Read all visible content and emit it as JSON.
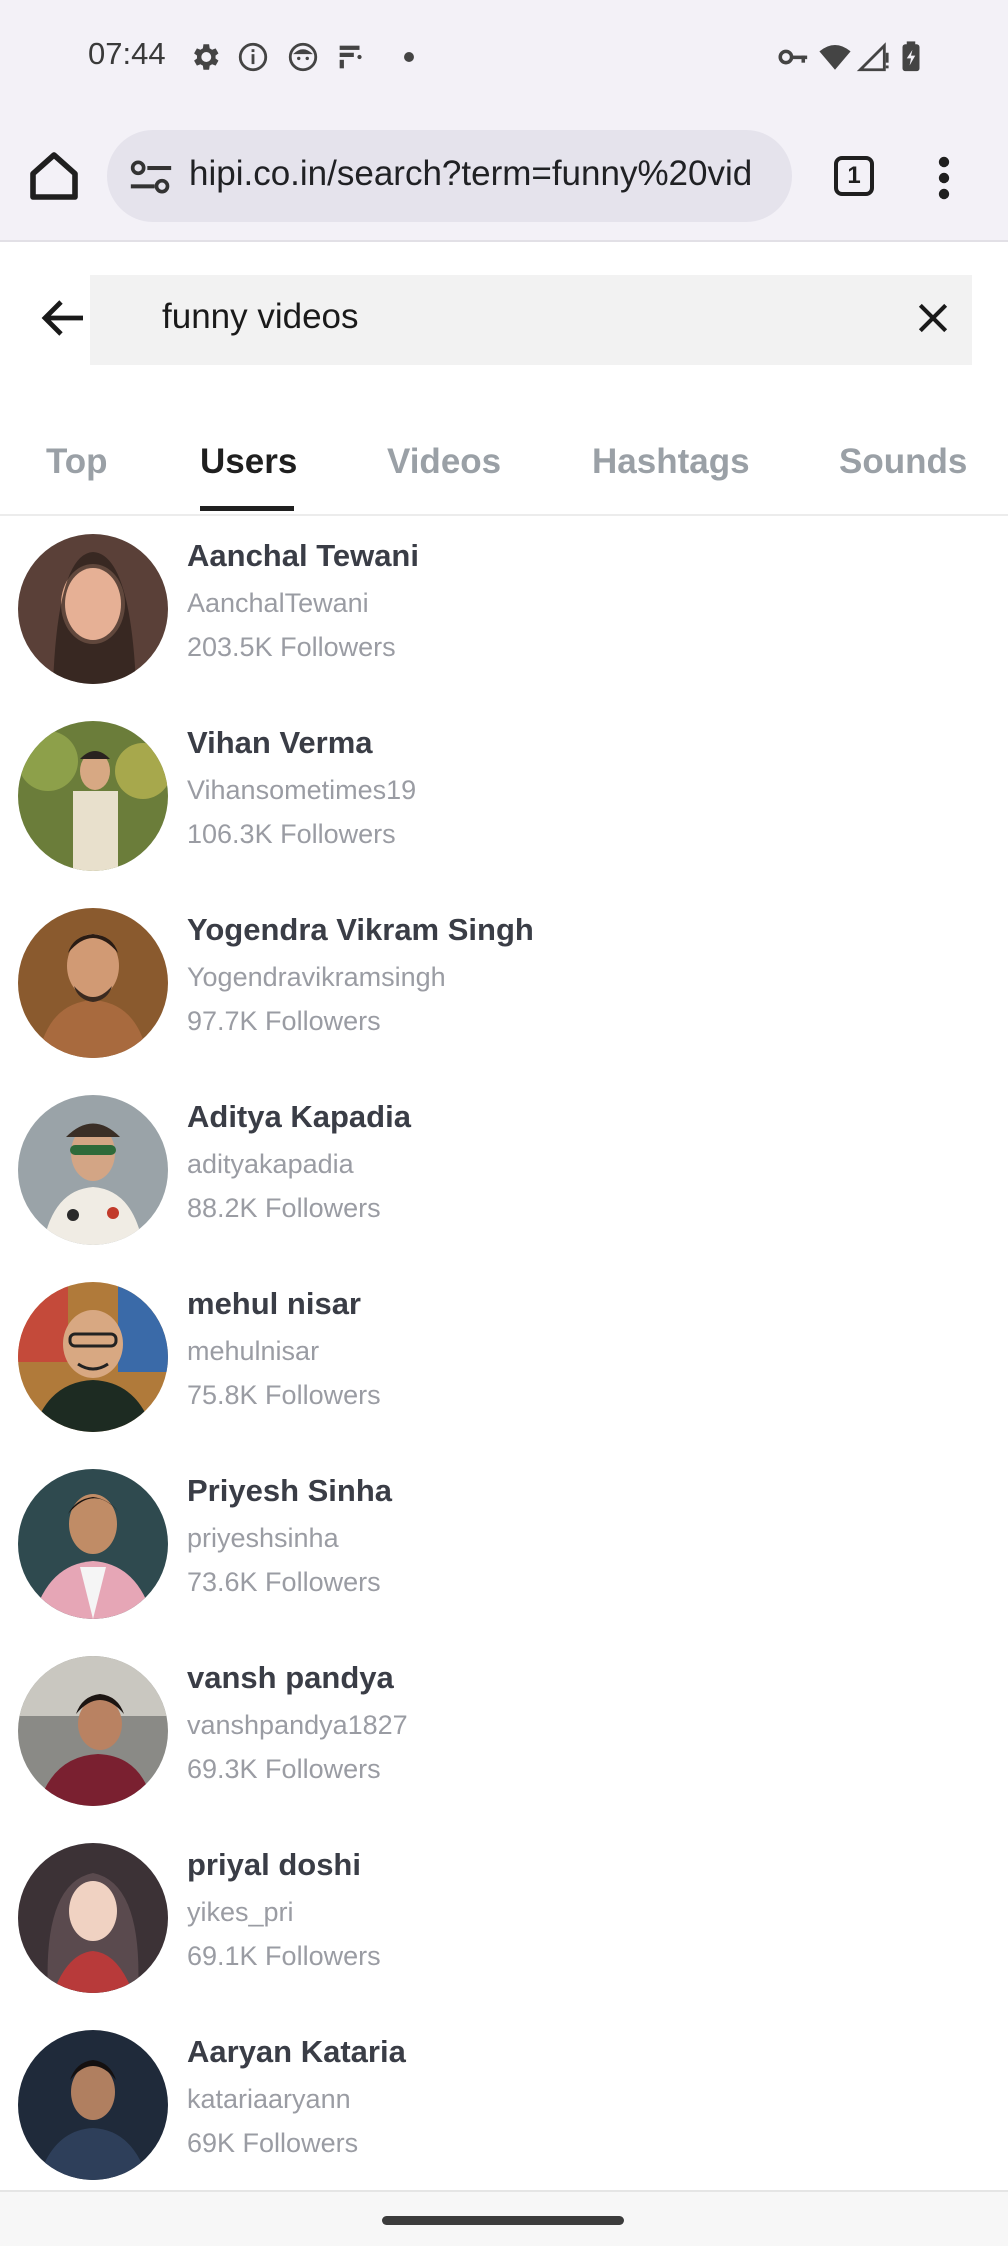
{
  "status_bar": {
    "time": "07:44",
    "left_icons": [
      "gear-icon",
      "info-icon",
      "face-icon",
      "data-saver-icon",
      "dot-icon"
    ],
    "right_icons": [
      "vpn-key-icon",
      "wifi-icon",
      "signal-icon",
      "battery-icon"
    ]
  },
  "browser": {
    "url": "hipi.co.in/search?term=funny%20vid",
    "tab_count": "1"
  },
  "search": {
    "query": "funny videos"
  },
  "tabs": [
    {
      "label": "Top",
      "active": false
    },
    {
      "label": "Users",
      "active": true
    },
    {
      "label": "Videos",
      "active": false
    },
    {
      "label": "Hashtags",
      "active": false
    },
    {
      "label": "Sounds",
      "active": false
    }
  ],
  "users": [
    {
      "name": "Aanchal Tewani",
      "handle": "AanchalTewani",
      "followers": "203.5K Followers",
      "avatar_color": "#5a4038"
    },
    {
      "name": "Vihan Verma",
      "handle": "Vihansometimes19",
      "followers": "106.3K Followers",
      "avatar_color": "#6b7d3a"
    },
    {
      "name": "Yogendra Vikram Singh",
      "handle": "Yogendravikramsingh",
      "followers": "97.7K Followers",
      "avatar_color": "#8a5a2e"
    },
    {
      "name": "Aditya Kapadia",
      "handle": "adityakapadia",
      "followers": "88.2K Followers",
      "avatar_color": "#9aa3a8"
    },
    {
      "name": "mehul nisar",
      "handle": "mehulnisar",
      "followers": "75.8K Followers",
      "avatar_color": "#b07a3a"
    },
    {
      "name": "Priyesh Sinha",
      "handle": "priyeshsinha",
      "followers": "73.6K Followers",
      "avatar_color": "#2f4a4f"
    },
    {
      "name": "vansh pandya",
      "handle": "vanshpandya1827",
      "followers": "69.3K Followers",
      "avatar_color": "#8a8a86"
    },
    {
      "name": "priyal doshi",
      "handle": "yikes_pri",
      "followers": "69.1K Followers",
      "avatar_color": "#3c3236"
    },
    {
      "name": "Aaryan Kataria",
      "handle": "katariaaryann",
      "followers": "69K Followers",
      "avatar_color": "#1f2a3a"
    }
  ]
}
